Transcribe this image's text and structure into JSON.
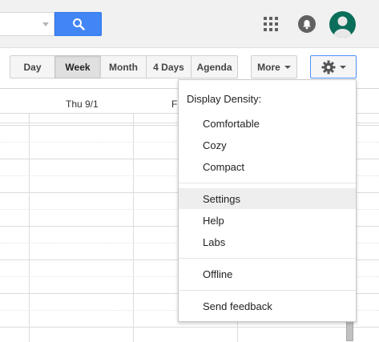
{
  "view_buttons": [
    {
      "label": "Day"
    },
    {
      "label": "Week"
    },
    {
      "label": "Month"
    },
    {
      "label": "4 Days"
    },
    {
      "label": "Agenda"
    }
  ],
  "more_label": "More",
  "calendar": {
    "day_headers": [
      "Thu 9/1",
      "F"
    ]
  },
  "settings_menu": {
    "heading": "Display Density:",
    "density_items": [
      "Comfortable",
      "Cozy",
      "Compact"
    ],
    "items": [
      "Settings",
      "Help",
      "Labs"
    ],
    "offline": "Offline",
    "feedback": "Send feedback",
    "highlighted": "Settings"
  },
  "colors": {
    "accent": "#4285f4",
    "avatar": "#0b6e5b",
    "topbar": "#f1f1f1"
  },
  "icons": [
    "search-icon",
    "apps-grid-icon",
    "notification-bell-icon",
    "account-avatar-icon",
    "gear-icon",
    "chevron-down-icon"
  ]
}
